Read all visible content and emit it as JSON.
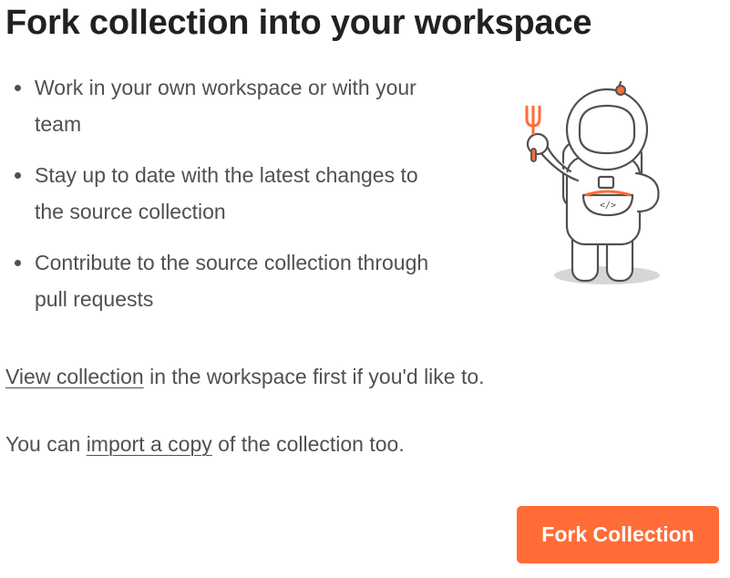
{
  "title": "Fork collection into your workspace",
  "benefits": [
    "Work in your own workspace or with your team",
    "Stay up to date with the latest changes to the source collection",
    "Contribute to the source collection through pull requests"
  ],
  "view_paragraph": {
    "link": "View collection",
    "text": " in the workspace first if you'd like to."
  },
  "import_paragraph": {
    "prefix": "You can ",
    "link": "import a copy",
    "suffix": " of the collection too."
  },
  "fork_button": {
    "label": "Fork Collection"
  },
  "illustration": {
    "icon": "astronaut-with-fork-and-bowl-icon",
    "bowl_label": "</>"
  },
  "colors": {
    "accent": "#FF6C37",
    "title_text": "#212121",
    "body_text": "#505050",
    "illustration_outline": "#505050",
    "illustration_shadow": "#D6D6D6"
  }
}
